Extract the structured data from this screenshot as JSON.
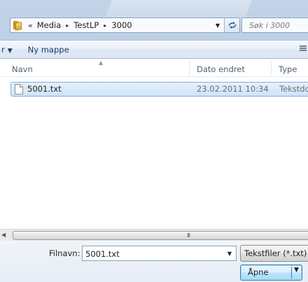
{
  "address": {
    "overflow_chevrons": "«",
    "breadcrumbs": [
      "Media",
      "TestLP",
      "3000"
    ],
    "separator": "▸",
    "dropdown_glyph": "▼"
  },
  "search": {
    "placeholder": "Søk i 3000"
  },
  "toolbar": {
    "organize_label": "r",
    "organize_arrow": "▼",
    "new_folder_label": "Ny mappe",
    "view_icon": "list-view-icon"
  },
  "columns": {
    "name": "Navn",
    "date": "Dato endret",
    "type": "Type",
    "sort_indicator": "▲"
  },
  "files": [
    {
      "name": "5001.txt",
      "modified": "23.02.2011 10:34",
      "type": "Tekstdo",
      "icon": "text-file-icon",
      "selected": true
    }
  ],
  "scrollbar": {
    "left_arrow": "◀",
    "grip": "III"
  },
  "filename": {
    "label": "Filnavn:",
    "value": "5001.txt",
    "dropdown_glyph": "▼"
  },
  "filter": {
    "label": "Tekstfiler (*.txt)"
  },
  "open_button": {
    "label": "Åpne",
    "dropdown_glyph": "▼"
  },
  "colors": {
    "accent": "#3c7fb1",
    "selection": "#cfe4f8",
    "link_text": "#1e3c6e"
  }
}
